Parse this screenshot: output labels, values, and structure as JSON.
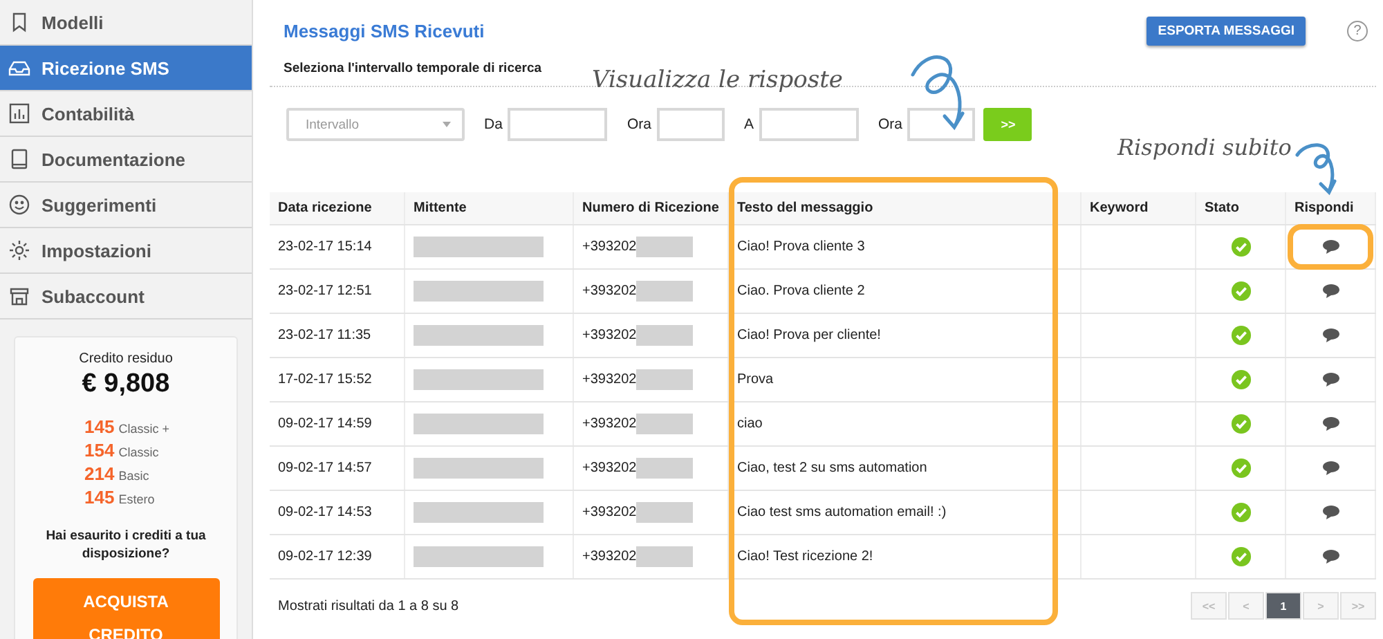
{
  "sidebar": {
    "items": [
      {
        "label": "Modelli",
        "selected": false
      },
      {
        "label": "Ricezione SMS",
        "selected": true
      },
      {
        "label": "Contabilità",
        "selected": false
      },
      {
        "label": "Documentazione",
        "selected": false
      },
      {
        "label": "Suggerimenti",
        "selected": false
      },
      {
        "label": "Impostazioni",
        "selected": false
      },
      {
        "label": "Subaccount",
        "selected": false
      }
    ],
    "credit": {
      "label": "Credito residuo",
      "amount": "€ 9,808",
      "lines": [
        {
          "count": "145",
          "name": "Classic +"
        },
        {
          "count": "154",
          "name": "Classic"
        },
        {
          "count": "214",
          "name": "Basic"
        },
        {
          "count": "145",
          "name": "Estero"
        }
      ],
      "question": "Hai esaurito i crediti a tua disposizione?",
      "button": "ACQUISTA CREDITO"
    }
  },
  "page": {
    "title": "Messaggi SMS Ricevuti",
    "export_button": "ESPORTA MESSAGGI",
    "help": "?",
    "subtitle": "Seleziona l'intervallo temporale di ricerca"
  },
  "filter": {
    "range_placeholder": "Intervallo",
    "from_label": "Da",
    "time_label": "Ora",
    "to_label": "A",
    "time_label_2": "Ora",
    "go_button": ">>"
  },
  "table": {
    "columns": [
      "Data ricezione",
      "Mittente",
      "Numero di Ricezione",
      "Testo del messaggio",
      "Keyword",
      "Stato",
      "Rispondi"
    ],
    "rows": [
      {
        "date": "23-02-17 15:14",
        "number": "+393202",
        "text": "Ciao! Prova cliente 3"
      },
      {
        "date": "23-02-17 12:51",
        "number": "+393202",
        "text": "Ciao. Prova cliente 2"
      },
      {
        "date": "23-02-17 11:35",
        "number": "+393202",
        "text": "Ciao! Prova per cliente!"
      },
      {
        "date": "17-02-17 15:52",
        "number": "+393202",
        "text": "Prova"
      },
      {
        "date": "09-02-17 14:59",
        "number": "+393202",
        "text": "ciao"
      },
      {
        "date": "09-02-17 14:57",
        "number": "+393202",
        "text": "Ciao, test 2 su sms automation"
      },
      {
        "date": "09-02-17 14:53",
        "number": "+393202",
        "text": "Ciao test sms automation email! :)"
      },
      {
        "date": "09-02-17 12:39",
        "number": "+393202",
        "text": "Ciao! Test ricezione 2!"
      }
    ]
  },
  "footer": {
    "summary": "Mostrati risultati da 1 a 8 su 8",
    "pages": [
      {
        "label": "<<",
        "selected": false
      },
      {
        "label": "<",
        "selected": false
      },
      {
        "label": "1",
        "selected": true
      },
      {
        "label": ">",
        "selected": false
      },
      {
        "label": ">>",
        "selected": false
      }
    ]
  },
  "annotations": [
    {
      "kind": "messages-column",
      "text": "Visualizza le risposte"
    },
    {
      "kind": "reply-button",
      "text": "Rispondi subito"
    }
  ]
}
